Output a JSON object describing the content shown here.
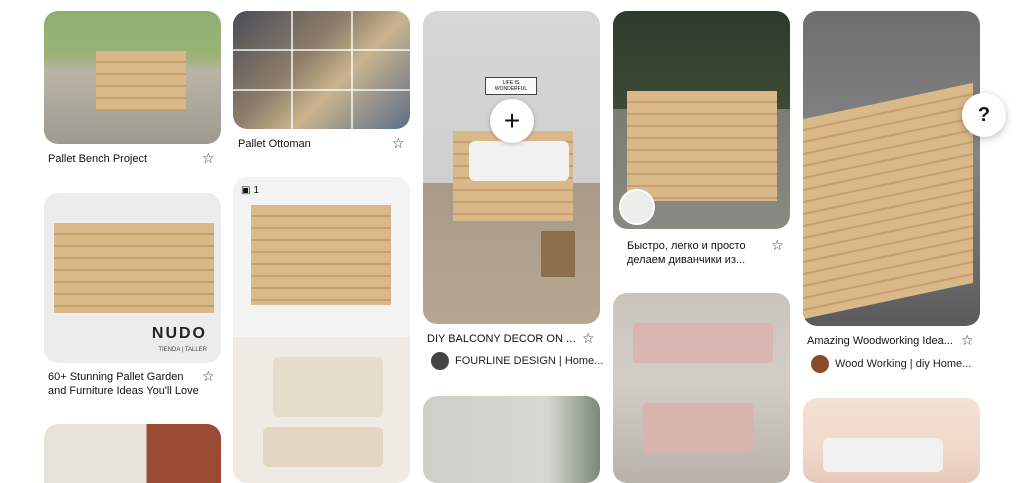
{
  "pins": [
    {
      "id": "pallet-bench",
      "title": "Pallet Bench Project"
    },
    {
      "id": "pallet-ottoman",
      "title": "Pallet Ottoman"
    },
    {
      "id": "balcony",
      "title": "DIY BALCONY DECOR ON A...",
      "source": "FOURLINE DESIGN | Home..."
    },
    {
      "id": "divan",
      "title_line1": "Быстро, легко и просто",
      "title_line2": "делаем диванчики из..."
    },
    {
      "id": "amazing",
      "title": "Amazing Woodworking Idea...",
      "source": "Wood Working | diy Home..."
    },
    {
      "id": "nudo",
      "title_line1": "60+ Stunning Pallet Garden",
      "title_line2": "and Furniture Ideas You'll Love",
      "brand": "NUDO",
      "brand_sub": "TIENDA | TALLER"
    },
    {
      "id": "multi",
      "badge_count": "1"
    }
  ],
  "balcony_sign": "LIFE IS WONDERFUL",
  "help_label": "?",
  "plus_label": "+",
  "icons": {
    "star": "star-outline-icon",
    "plus": "plus-icon",
    "help": "help-icon",
    "multi": "multi-image-icon"
  }
}
